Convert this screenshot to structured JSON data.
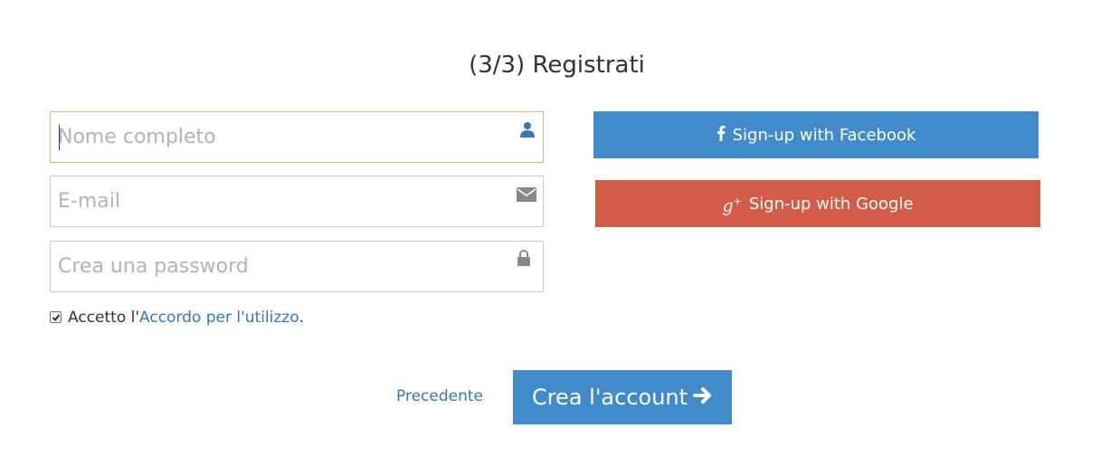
{
  "page": {
    "title": "(3/3) Registrati"
  },
  "form": {
    "fullname": {
      "placeholder": "Nome completo",
      "value": "",
      "icon": "user-icon"
    },
    "email": {
      "placeholder": "E-mail",
      "value": "",
      "icon": "envelope-icon"
    },
    "password": {
      "placeholder": "Crea una password",
      "value": "",
      "icon": "lock-icon"
    },
    "agreement": {
      "checked": true,
      "prefix": "Accetto l'",
      "link_text": "Accordo per l'utilizzo",
      "suffix": "."
    }
  },
  "social": {
    "facebook_label": "Sign-up with Facebook",
    "facebook_icon": "facebook-icon",
    "google_label": "Sign-up with Google",
    "google_icon": "google-plus-icon"
  },
  "actions": {
    "previous_label": "Precedente",
    "create_label": "Crea l'account",
    "create_icon": "arrow-right-icon"
  },
  "colors": {
    "facebook": "#428bca",
    "google": "#d35c48",
    "primary": "#428bca",
    "link": "#337ab7",
    "focus_border": "#e4b577"
  }
}
